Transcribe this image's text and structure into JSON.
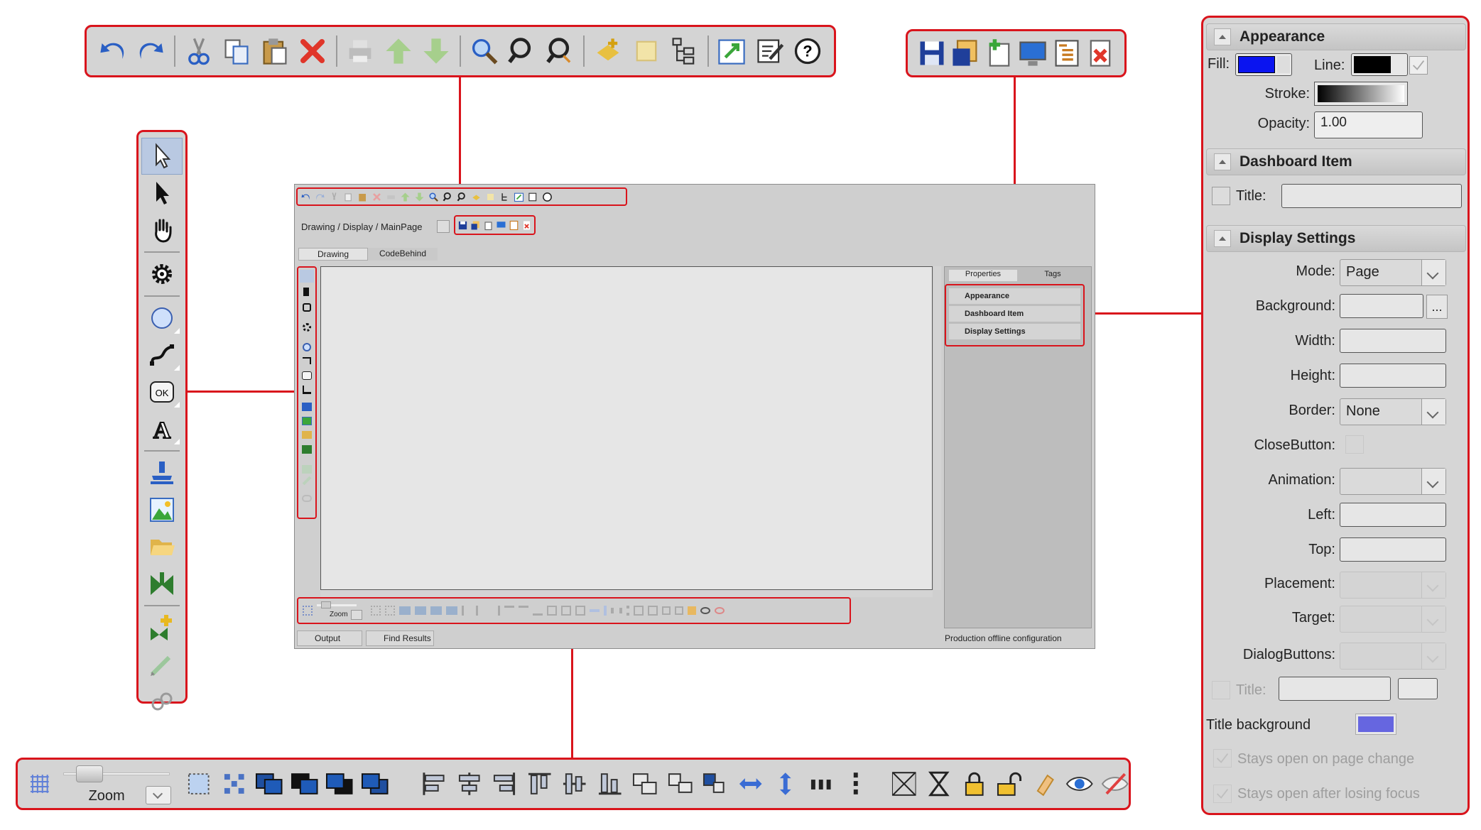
{
  "top_toolbar": {
    "icons": [
      "undo-icon",
      "redo-icon",
      "cut-icon",
      "copy-icon",
      "paste-icon",
      "delete-icon",
      "print-icon",
      "move-up-icon",
      "move-down-icon",
      "zoom-icon",
      "zoom-in-icon",
      "zoom-out-icon",
      "add-item-icon",
      "note-icon",
      "tree-icon",
      "export-icon",
      "edit-icon",
      "help-icon"
    ]
  },
  "file_toolbar": {
    "icons": [
      "save-icon",
      "save-as-icon",
      "new-page-icon",
      "display-icon",
      "layout-icon",
      "close-page-icon"
    ]
  },
  "left_toolbar": {
    "icons": [
      "select-icon",
      "pointer-icon",
      "hand-icon",
      "gear-icon",
      "ellipse-icon",
      "polyline-icon",
      "button-icon",
      "text-icon",
      "stamp-icon",
      "image-icon",
      "folder-icon",
      "valve-icon",
      "add-symbol-icon",
      "pen-icon",
      "link-icon"
    ],
    "button_text": "OK",
    "text_glyph": "A"
  },
  "window": {
    "breadcrumb": "Drawing / Display / MainPage",
    "tabs": [
      "Drawing",
      "CodeBehind"
    ],
    "panel_tabs": [
      "Properties",
      "Tags"
    ],
    "panel_sections": [
      "Appearance",
      "Dashboard Item",
      "Display Settings"
    ],
    "zoom_label": "Zoom",
    "bottom_tabs": [
      "Output",
      "Find Results"
    ],
    "status": "Production offline configuration"
  },
  "bottom_toolbar": {
    "zoom_label": "Zoom"
  },
  "properties": {
    "appearance": {
      "title": "Appearance",
      "fill_label": "Fill:",
      "line_label": "Line:",
      "stroke_label": "Stroke:",
      "opacity_label": "Opacity:",
      "opacity_value": "1.00",
      "fill_color": "#0a14f0",
      "line_color": "#000000"
    },
    "dashboard": {
      "title": "Dashboard Item",
      "title_label": "Title:"
    },
    "display": {
      "title": "Display Settings",
      "mode_label": "Mode:",
      "mode_value": "Page",
      "background_label": "Background:",
      "browse": "...",
      "width_label": "Width:",
      "height_label": "Height:",
      "border_label": "Border:",
      "border_value": "None",
      "closebutton_label": "CloseButton:",
      "animation_label": "Animation:",
      "left_label": "Left:",
      "top_label": "Top:",
      "placement_label": "Placement:",
      "target_label": "Target:",
      "dialogbuttons_label": "DialogButtons:",
      "title_label": "Title:",
      "title_background_label": "Title background",
      "title_background_color": "#6666e0",
      "stays_open_page": "Stays open on page change",
      "stays_open_focus": "Stays open after losing focus"
    }
  }
}
